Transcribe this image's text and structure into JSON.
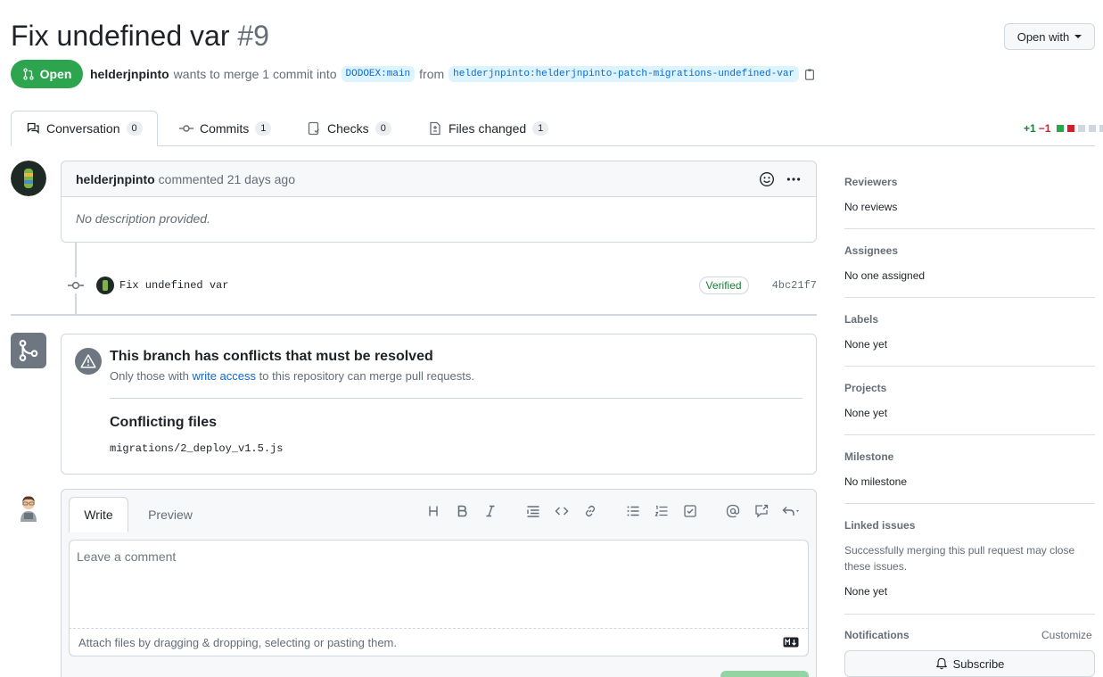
{
  "header": {
    "title": "Fix undefined var",
    "number": "#9",
    "open_with": "Open with",
    "state": "Open",
    "author": "helderjnpinto",
    "merge_text": "wants to merge 1 commit into",
    "base_branch": "DODOEX:main",
    "from_text": "from",
    "head_branch": "helderjnpinto:helderjnpinto-patch-migrations-undefined-var"
  },
  "tabs": [
    {
      "label": "Conversation",
      "count": "0"
    },
    {
      "label": "Commits",
      "count": "1"
    },
    {
      "label": "Checks",
      "count": "0"
    },
    {
      "label": "Files changed",
      "count": "1"
    }
  ],
  "diffstat": {
    "added": "+1",
    "removed": "−1"
  },
  "comment": {
    "author": "helderjnpinto",
    "action": "commented 21 days ago",
    "body": "No description provided."
  },
  "commit": {
    "message": "Fix undefined var",
    "verified": "Verified",
    "sha": "4bc21f7"
  },
  "merge": {
    "heading": "This branch has conflicts that must be resolved",
    "sub_prefix": "Only those with",
    "sub_link": "write access",
    "sub_suffix": "to this repository can merge pull requests.",
    "conflicting_heading": "Conflicting files",
    "conflicting_file": "migrations/2_deploy_v1.5.js"
  },
  "editor": {
    "write_tab": "Write",
    "preview_tab": "Preview",
    "placeholder": "Leave a comment",
    "attach": "Attach files by dragging & dropping, selecting or pasting them."
  },
  "sidebar": {
    "reviewers": {
      "label": "Reviewers",
      "value": "No reviews"
    },
    "assignees": {
      "label": "Assignees",
      "value": "No one assigned"
    },
    "labels": {
      "label": "Labels",
      "value": "None yet"
    },
    "projects": {
      "label": "Projects",
      "value": "None yet"
    },
    "milestone": {
      "label": "Milestone",
      "value": "No milestone"
    },
    "linked": {
      "label": "Linked issues",
      "desc": "Successfully merging this pull request may close these issues.",
      "value": "None yet"
    },
    "notifications": {
      "label": "Notifications",
      "customize": "Customize",
      "subscribe": "Subscribe"
    }
  },
  "colors": {
    "open": "#2da44e",
    "link": "#0969da",
    "added": "#1a7f37",
    "removed": "#cf222e"
  }
}
